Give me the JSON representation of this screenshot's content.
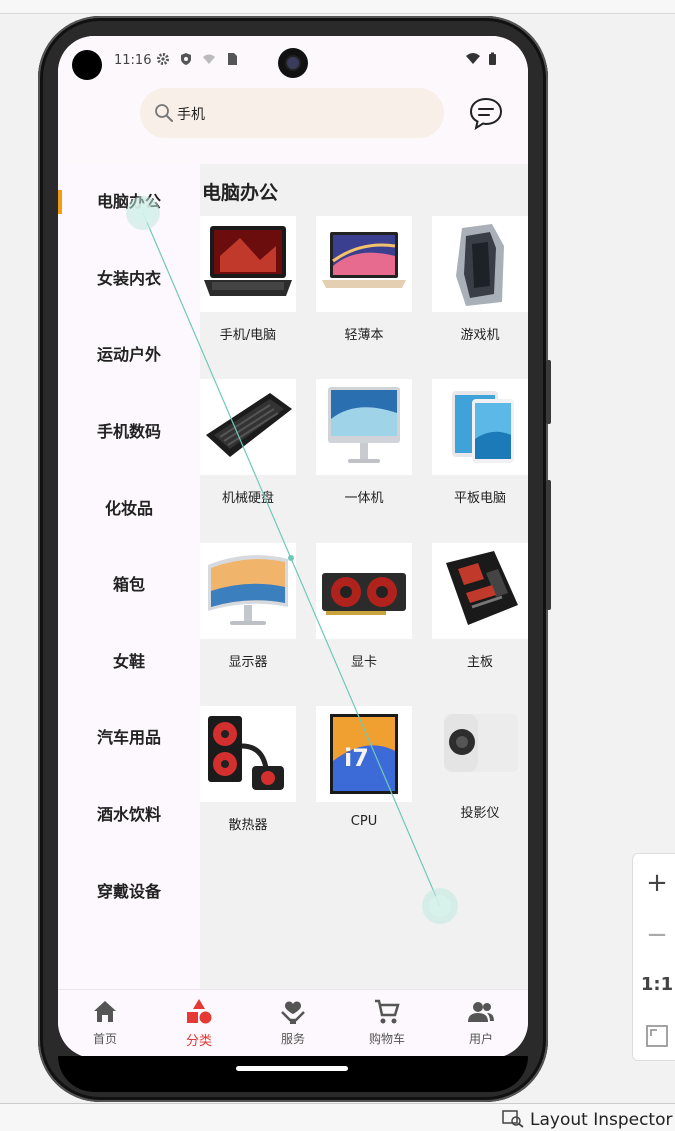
{
  "status_bar": {
    "time": "11:16"
  },
  "search": {
    "value": "手机",
    "icon": "search-icon"
  },
  "header": {
    "message_icon": "chat-bubble-icon"
  },
  "sidebar": {
    "items": [
      {
        "label": "电脑办公",
        "active": true
      },
      {
        "label": "女装内衣"
      },
      {
        "label": "运动户外"
      },
      {
        "label": "手机数码"
      },
      {
        "label": "化妆品"
      },
      {
        "label": "箱包"
      },
      {
        "label": "女鞋"
      },
      {
        "label": "汽车用品"
      },
      {
        "label": "酒水饮料"
      },
      {
        "label": "穿戴设备"
      }
    ],
    "accent_color": "#f39c12"
  },
  "content": {
    "title": "电脑办公",
    "products": [
      {
        "label": "手机/电脑",
        "image": "laptop-image"
      },
      {
        "label": "轻薄本",
        "image": "thin-laptop-image"
      },
      {
        "label": "游戏机",
        "image": "gaming-pc-image"
      },
      {
        "label": "机械硬盘",
        "image": "keyboard-image"
      },
      {
        "label": "一体机",
        "image": "all-in-one-image"
      },
      {
        "label": "平板电脑",
        "image": "tablet-image"
      },
      {
        "label": "显示器",
        "image": "monitor-image"
      },
      {
        "label": "显卡",
        "image": "graphics-card-image"
      },
      {
        "label": "主板",
        "image": "motherboard-image"
      },
      {
        "label": "散热器",
        "image": "cooler-image"
      },
      {
        "label": "CPU",
        "image": "cpu-image"
      },
      {
        "label": "投影仪",
        "image": "projector-image"
      }
    ]
  },
  "tabbar": {
    "tabs": [
      {
        "label": "首页",
        "icon": "home-icon"
      },
      {
        "label": "分类",
        "icon": "category-icon",
        "active": true
      },
      {
        "label": "服务",
        "icon": "service-icon"
      },
      {
        "label": "购物车",
        "icon": "cart-icon"
      },
      {
        "label": "用户",
        "icon": "user-icon"
      }
    ],
    "active_color": "#e53935"
  },
  "zoom_toolbar": {
    "zoom_in": "+",
    "zoom_out": "−",
    "actual_size": "1:1"
  },
  "bottom_bar": {
    "inspector_label": "Layout Inspector"
  }
}
